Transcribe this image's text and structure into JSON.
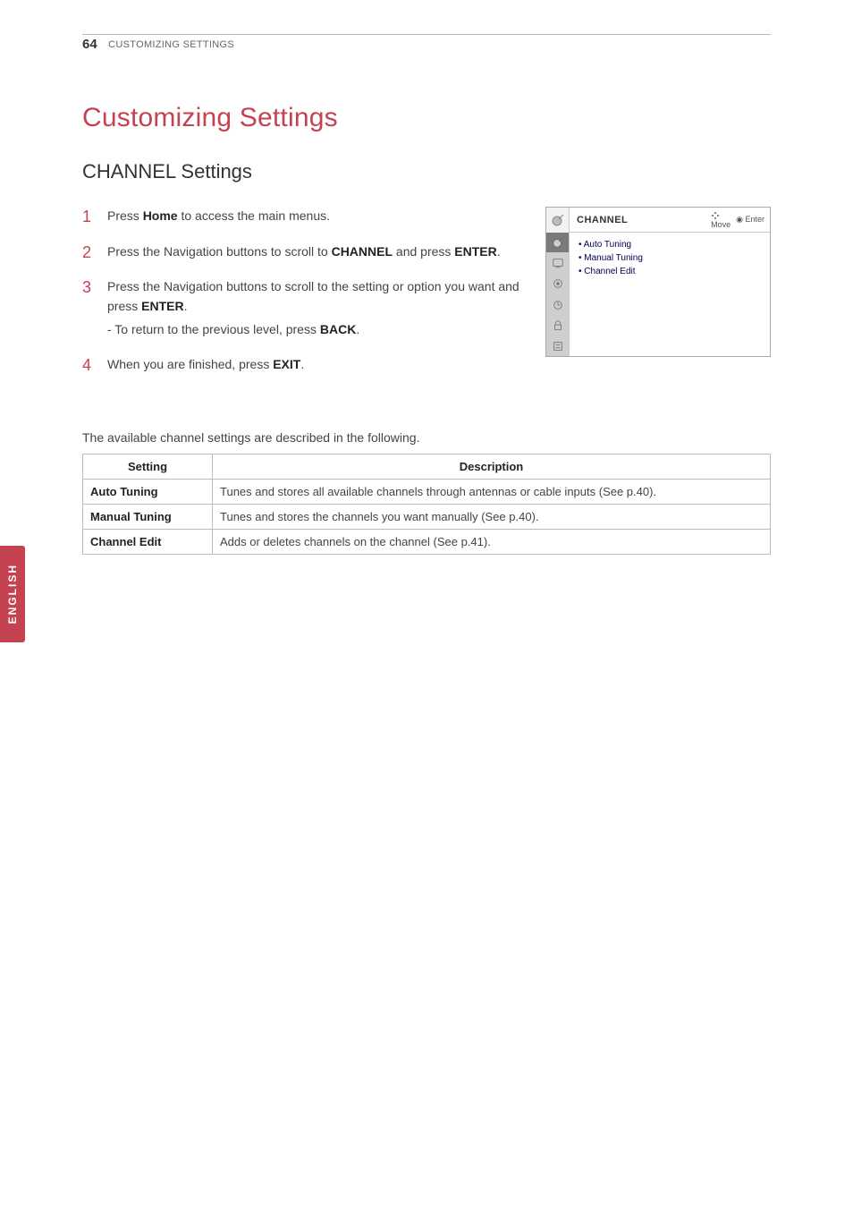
{
  "header": {
    "page_number": "64",
    "section": "CUSTOMIZING SETTINGS"
  },
  "side_tab": "ENGLISH",
  "titles": {
    "main": "Customizing Settings",
    "sub": "CHANNEL Settings"
  },
  "steps": [
    {
      "pre": "Press ",
      "b1": "Home",
      "post": " to access the main menus."
    },
    {
      "pre": "Press the Navigation buttons to scroll to ",
      "b1": "CHANNEL",
      "mid": " and press ",
      "b2": "ENTER",
      "post": "."
    },
    {
      "pre": "Press the Navigation buttons to scroll to the setting or option you want and press ",
      "b1": "ENTER",
      "post": ".",
      "sub_pre": "- To return to the previous level, press ",
      "sub_b": "BACK",
      "sub_post": "."
    },
    {
      "pre": "When you are finished, press ",
      "b1": "EXIT",
      "post": "."
    }
  ],
  "osd": {
    "title": "CHANNEL",
    "hint_move": "Move",
    "hint_enter": "Enter",
    "items": [
      "Auto Tuning",
      "Manual Tuning",
      "Channel Edit"
    ],
    "tabs": [
      "dish-icon",
      "screen-icon",
      "speaker-icon",
      "clock-icon",
      "lock-icon",
      "option-icon"
    ]
  },
  "table_intro": "The available channel settings are described in the following.",
  "table": {
    "headers": {
      "setting": "Setting",
      "description": "Description"
    },
    "rows": [
      {
        "name": "Auto Tuning",
        "desc": "Tunes and stores all available channels through antennas or cable inputs (See p.40)."
      },
      {
        "name": "Manual Tuning",
        "desc": "Tunes and stores the channels you want manually (See p.40)."
      },
      {
        "name": "Channel Edit",
        "desc": "Adds or deletes channels on the channel (See p.41)."
      }
    ]
  }
}
